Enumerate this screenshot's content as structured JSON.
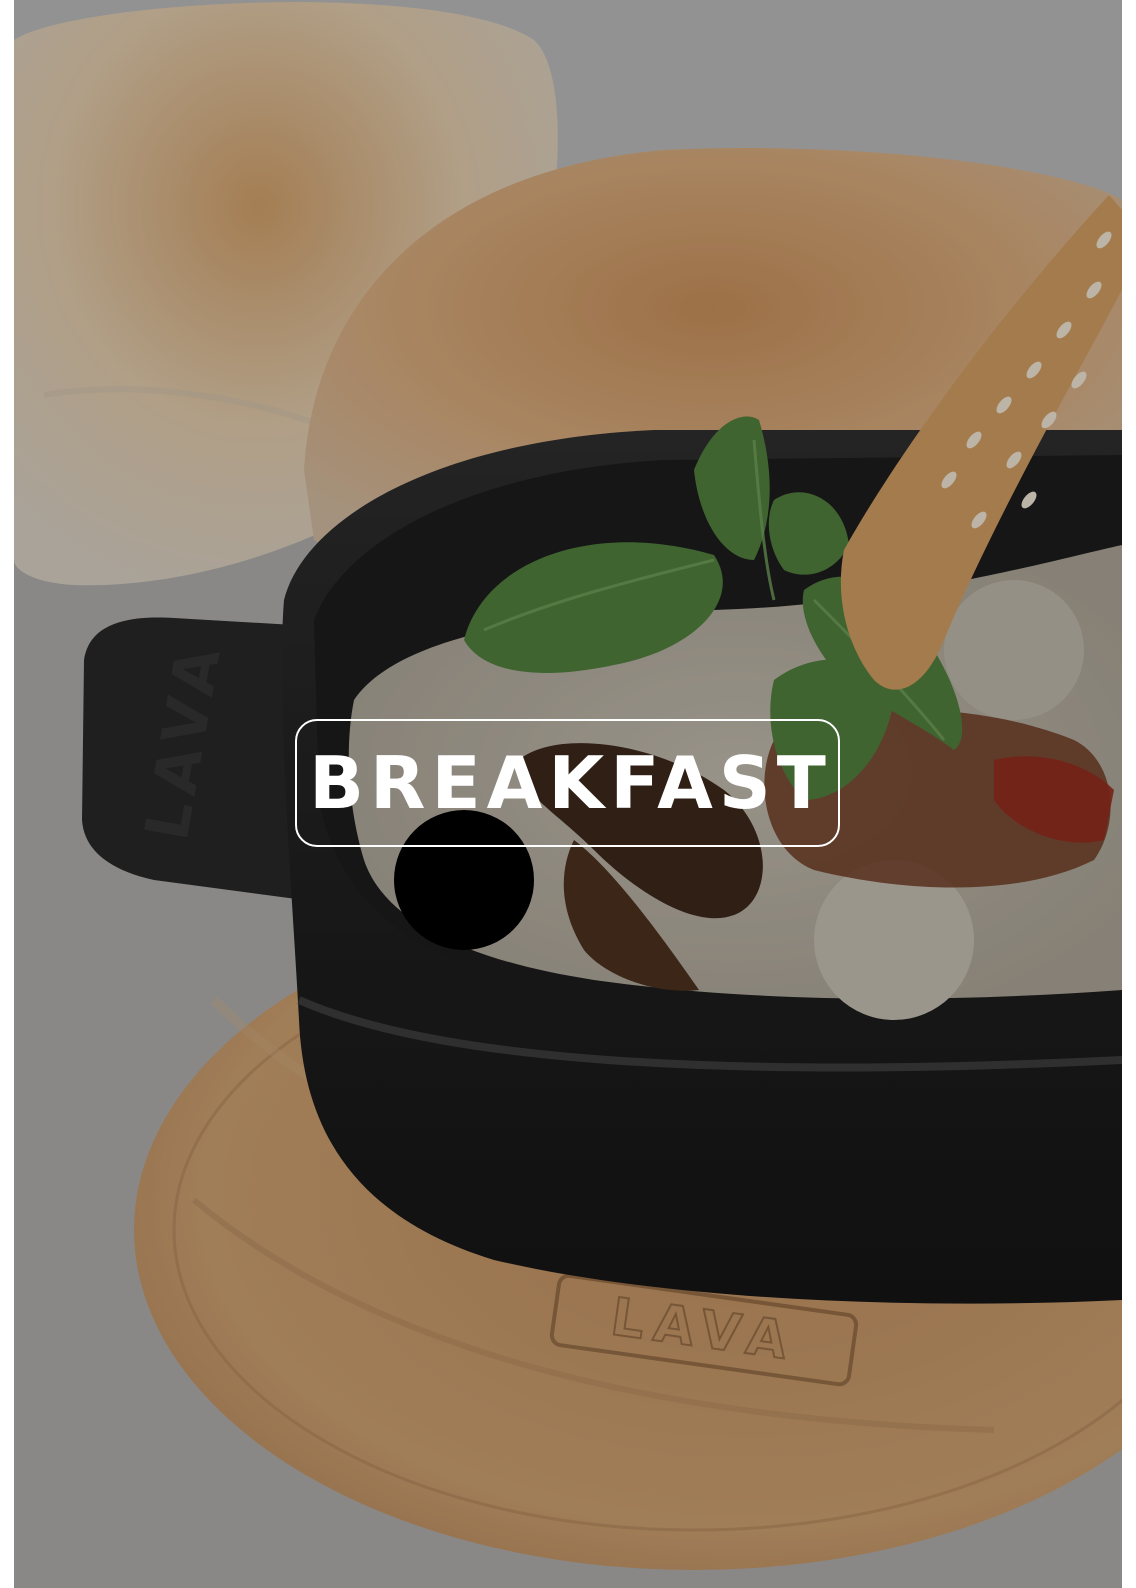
{
  "menu_section": {
    "title": "BREAKFAST"
  },
  "photo": {
    "subject": "food-photo",
    "engraving": "LAVA"
  },
  "colors": {
    "title_text": "#ffffff",
    "title_border": "#ffffff",
    "overlay": "rgba(0,0,0,0.18)"
  }
}
